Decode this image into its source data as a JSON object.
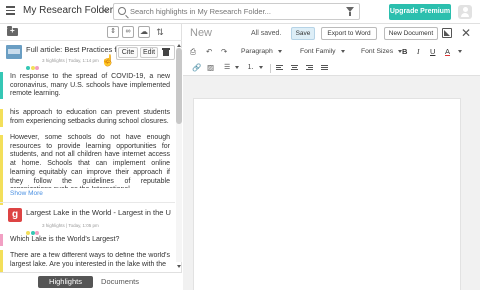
{
  "header": {
    "title": "My Research Folder",
    "search_placeholder": "Search highlights in My Research Folder...",
    "upgrade_label": "Upgrade Premium"
  },
  "left_panel": {
    "cards": [
      {
        "title": "Full article: Best Practices for Recovering from School Closures",
        "meta": "3 highlights | Today, 1:14 pm",
        "popup": {
          "cite_label": "Cite",
          "edit_label": "Edit"
        },
        "highlights": [
          "In response to the spread of COVID-19, a new coronavirus, many U.S. schools have implemented remote learning.",
          "his approach to education can prevent students from experiencing setbacks during school closures.",
          "However, some schools do not have enough resources to provide learning opportunities for students, and not all children have internet access at home. Schools that can implement online learning equitably can improve their approach if they follow the guidelines of reputable organizations such as the International"
        ],
        "show_more": "Show More"
      },
      {
        "title": "Largest Lake in the World - Largest in the United States",
        "meta": "3 highlights | Today, 1:05 pm",
        "favicon_letter": "g",
        "highlights": [
          "Which Lake is the World's Largest?",
          "There are a few different ways to define the world's largest lake. Are you interested in the lake with the"
        ]
      }
    ],
    "tabs": {
      "highlights": "Highlights",
      "documents": "Documents"
    }
  },
  "editor": {
    "doc_title": "New",
    "status": "All saved.",
    "save_label": "Save",
    "export_label": "Export to Word",
    "new_doc_label": "New Document",
    "paragraph": "Paragraph",
    "font_family": "Font Family",
    "font_size": "Font Sizes",
    "bold": "B",
    "italic": "I",
    "underline": "U",
    "font_color": "A"
  },
  "colors": {
    "accent": "#2bbfae",
    "highlight_teal": "#35c7b5",
    "highlight_yellow": "#f3df5a",
    "highlight_pink": "#f1a0c3",
    "link": "#4a90e2"
  },
  "icons": [
    "menu-icon",
    "chevron-down-icon",
    "search-icon",
    "filter-icon",
    "user-icon",
    "new-folder-icon",
    "sort-icon",
    "link-icon",
    "upload-icon",
    "sort-alpha-icon",
    "trash-icon",
    "print-icon",
    "undo-icon",
    "redo-icon",
    "image-icon",
    "bullet-list-icon",
    "numbered-list-icon",
    "align-left-icon",
    "align-center-icon",
    "align-right-icon",
    "justify-icon",
    "expand-icon",
    "close-icon"
  ]
}
